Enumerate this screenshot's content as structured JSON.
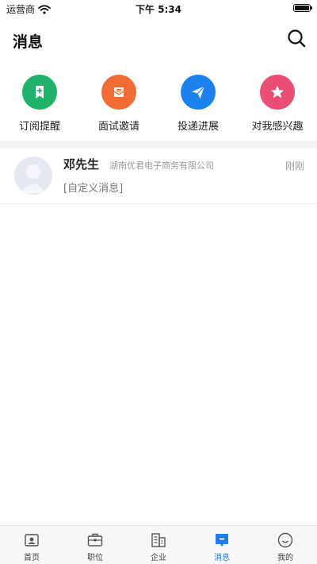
{
  "status_bar": {
    "carrier": "运营商",
    "time": "下午 5:34"
  },
  "header": {
    "title": "消息"
  },
  "quick_actions": [
    {
      "label": "订阅提醒",
      "icon": "bookmark-plus-icon",
      "color": "#1fb36a"
    },
    {
      "label": "面试邀请",
      "icon": "mail-icon",
      "color": "#f26b35"
    },
    {
      "label": "投递进展",
      "icon": "paper-plane-icon",
      "color": "#1c82f0"
    },
    {
      "label": "对我感兴趣",
      "icon": "star-icon",
      "color": "#ec4d74"
    }
  ],
  "messages": [
    {
      "sender": "邓先生",
      "company": "湖南优君电子商务有限公司",
      "time": "刚刚",
      "preview": "[自定义消息]"
    }
  ],
  "tabs": [
    {
      "label": "首页",
      "icon": "home-icon"
    },
    {
      "label": "职位",
      "icon": "briefcase-icon"
    },
    {
      "label": "企业",
      "icon": "building-icon"
    },
    {
      "label": "消息",
      "icon": "message-icon",
      "active": true
    },
    {
      "label": "我的",
      "icon": "profile-icon"
    }
  ],
  "colors": {
    "accent": "#1f7ff0",
    "background": "#ffffff",
    "separator": "#f3f4f6"
  }
}
